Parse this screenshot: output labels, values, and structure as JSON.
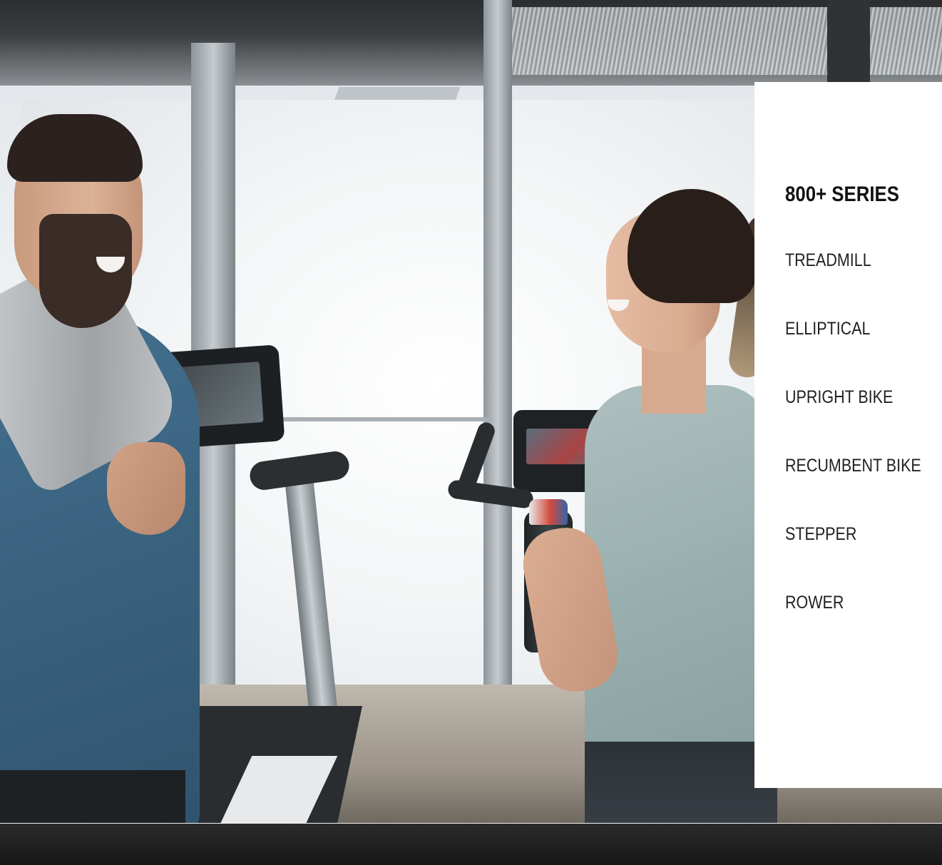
{
  "hero": {
    "alt": "Man and woman chatting in a gym next to a treadmill and a bike"
  },
  "menu": {
    "title": "800+ SERIES",
    "items": [
      {
        "label": "TREADMILL"
      },
      {
        "label": "ELLIPTICAL"
      },
      {
        "label": "UPRIGHT BIKE"
      },
      {
        "label": "RECUMBENT BIKE"
      },
      {
        "label": "STEPPER"
      },
      {
        "label": "ROWER"
      }
    ]
  },
  "colors": {
    "panel_background": "#ffffff",
    "text": "#121212",
    "bottom_bar": "#1c1c1c"
  }
}
